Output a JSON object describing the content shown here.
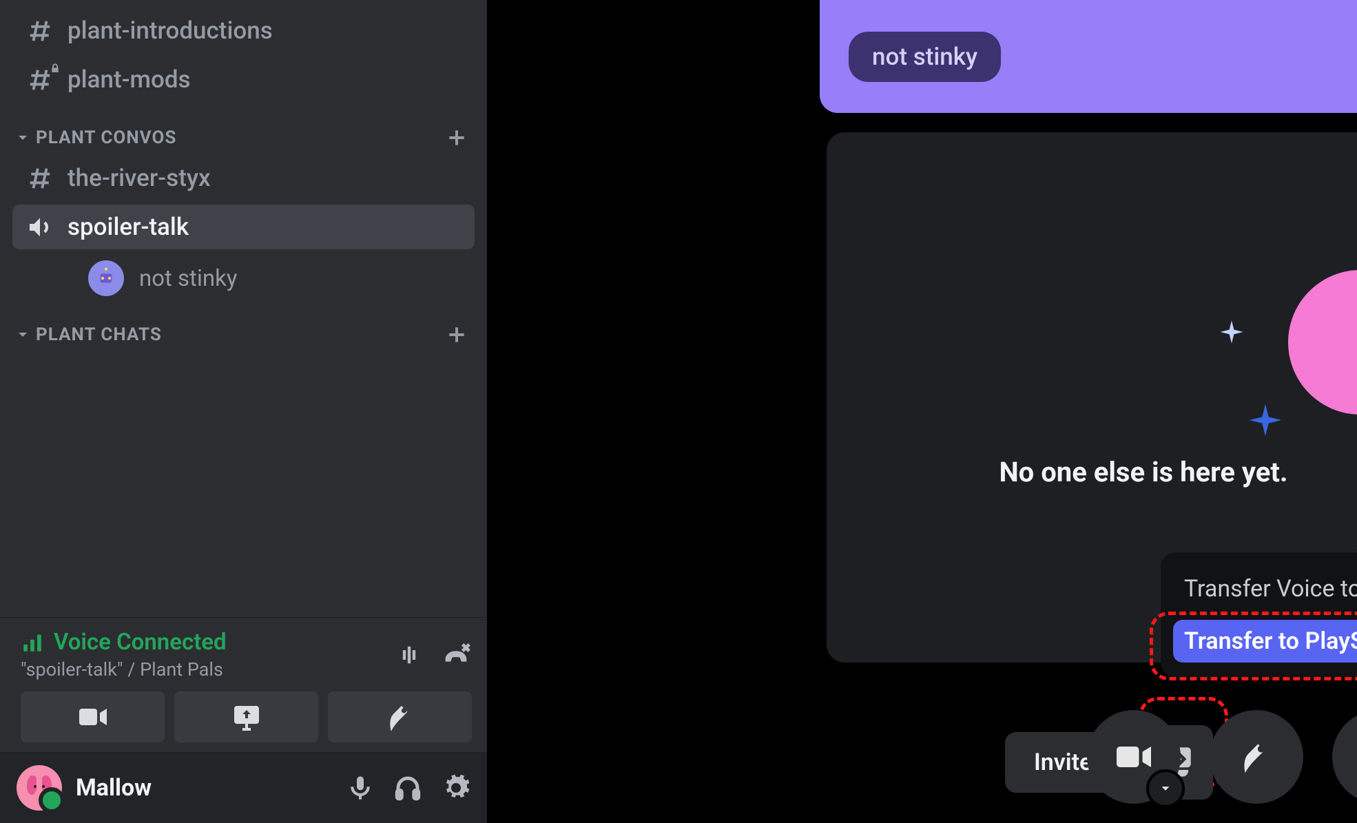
{
  "sidebar": {
    "channels_top": [
      {
        "name": "plant-introductions",
        "type": "text",
        "locked": false
      },
      {
        "name": "plant-mods",
        "type": "text",
        "locked": true
      }
    ],
    "category1": {
      "label": "PLANT CONVOS"
    },
    "channels_mid": [
      {
        "name": "the-river-styx",
        "type": "text"
      },
      {
        "name": "spoiler-talk",
        "type": "voice",
        "active": true
      }
    ],
    "voice_member": {
      "name": "not stinky"
    },
    "category2": {
      "label": "PLANT CHATS"
    }
  },
  "voice_panel": {
    "status": "Voice Connected",
    "channel": "\"spoiler-talk\" / Plant Pals"
  },
  "user": {
    "name": "Mallow"
  },
  "banner": {
    "pill": "not stinky"
  },
  "stage": {
    "empty_text": "No one else is here yet."
  },
  "transfer": {
    "xbox": "Transfer Voice to Xbox",
    "ps": "Transfer to PlayStation"
  },
  "bottom": {
    "invite": "Invite",
    "invite2": "In"
  }
}
